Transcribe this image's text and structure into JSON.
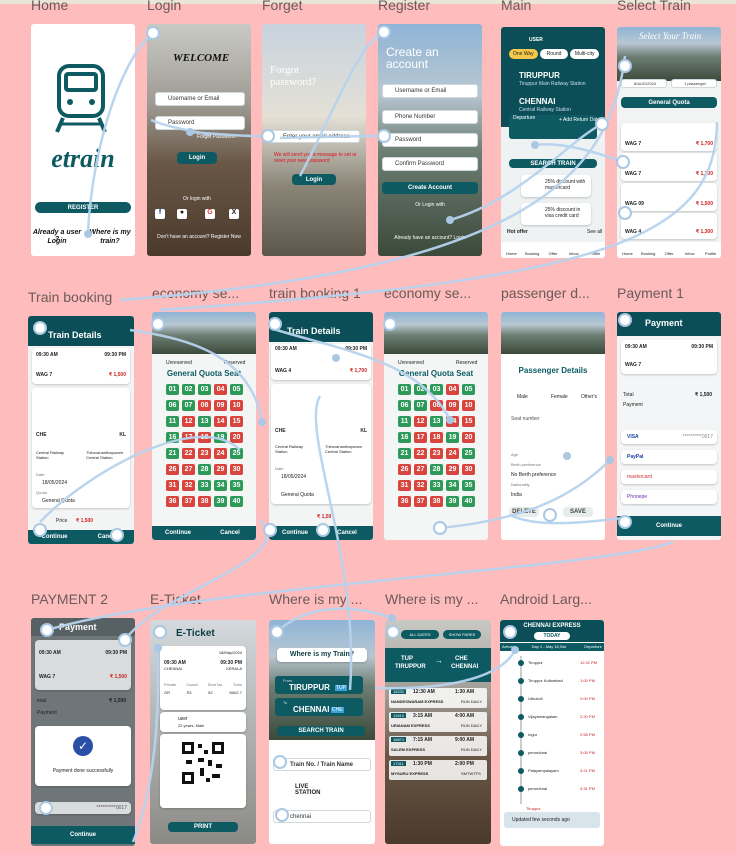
{
  "frames": {
    "home": {
      "label": "Home",
      "logo_text": "etrain",
      "register": "REGISTER",
      "already_user": "Already a user ?",
      "login": "Login",
      "where_is": "Where is my",
      "train": "train?"
    },
    "login": {
      "label": "Login",
      "welcome": "WELCOME",
      "username": "Username or Email",
      "password": "Password",
      "forget": "Forget Password?",
      "login_btn": "Login",
      "or_login": "Or login with",
      "no_account": "Don't have an account? Register Now"
    },
    "forget": {
      "label": "Forget",
      "title": "Forgot password?",
      "email": "Enter your email address",
      "note": "We will send you a message to set or reset your new password",
      "submit": "Login"
    },
    "register": {
      "label": "Register",
      "title": "Create an account",
      "username": "Username or Email",
      "phone": "Phone Number",
      "password": "Password",
      "confirm": "Confirm Password",
      "create": "Create Account",
      "or_login": "Or Login with",
      "already": "Already have an account? Login"
    },
    "main": {
      "label": "Main",
      "user": "USER",
      "tabs": [
        "One Way",
        "Round",
        "Multi-city"
      ],
      "from_code": "TIRUPPUR",
      "from_abbr": "TUP",
      "from_sub": "Tiruppur Main Railway Station",
      "to_code": "CHENNAI",
      "to_abbr": "CHE",
      "to_sub": "Central Railway Station",
      "departure": "Departure",
      "return": "+ Add Return Date",
      "traveller": "Traveller",
      "quota": "General Quota",
      "search": "SEARCH TRAIN",
      "offer1": "25% discount with mastercard",
      "offer2": "25% discount in visa credit card",
      "hot_offer": "Hot offer",
      "see_all": "See all",
      "nav": [
        "Home",
        "Booking",
        "Offer",
        "Inbox",
        "Profile"
      ]
    },
    "select_train": {
      "label": "Select Train",
      "title": "Select Your Train",
      "date": "8/AUG/2024",
      "passenger": "1 passenger",
      "quota": "General Quota",
      "trains": [
        {
          "name": "WAG 7",
          "price": "₹ 1,700"
        },
        {
          "name": "WAG 7",
          "price": "₹ 1,700"
        },
        {
          "name": "WAG 09",
          "price": "₹ 1,500"
        },
        {
          "name": "WAG 4",
          "price": "₹ 1,300"
        }
      ],
      "nav": [
        "Home",
        "Booking",
        "Offer",
        "Inbox",
        "Profile"
      ]
    },
    "train_booking": {
      "label": "Train booking",
      "title": "Train Details",
      "dep_time": "09:30 AM",
      "arr_time": "09:30 PM",
      "train": "WAG 7",
      "price_tag": "₹ 1,500",
      "from": "CHE",
      "to": "KL",
      "from_station": "Central Railway Station",
      "to_station": "Thiruvananthapuram Central Station",
      "date_label": "Date",
      "date": "18/05/2024",
      "quota_label": "Quota",
      "quota": "General Quota",
      "price_label": "Price",
      "price": "₹ 1,500",
      "continue": "Continue",
      "cancel": "Cancel"
    },
    "economy1": {
      "label": "economy se...",
      "unreserved": "Unreserved",
      "reserved": "Reserved",
      "title": "General Quota Seat",
      "continue": "Continue",
      "cancel": "Cancel"
    },
    "train_booking1": {
      "label": "train booking 1",
      "title": "Train Details",
      "dep_time": "09:30 AM",
      "arr_time": "09:30 PM",
      "from": "CHE",
      "to": "KL",
      "train": "WAG 4",
      "price_tag": "₹ 1,700",
      "from_station": "Central Railway Station",
      "to_station": "Thiruvananthapuram Central Station",
      "date_label": "Date",
      "date": "18/05/2024",
      "quota": "General Quota",
      "price": "₹ 1,50",
      "continue": "Continue",
      "cancel": "Cancel"
    },
    "economy2": {
      "label": "economy se...",
      "unreserved": "Unreserved",
      "reserved": "Reserved",
      "title": "General Quota Seat"
    },
    "passenger": {
      "label": "passenger d...",
      "title": "Passenger Details",
      "genders": [
        "Male",
        "Female",
        "Other's"
      ],
      "seat": "Seat number",
      "age": "Age",
      "pref": "Berth preference",
      "no_berth": "No Berth preference",
      "nation": "Nationality",
      "india": "India",
      "delete": "DELETE",
      "save": "SAVE"
    },
    "payment1": {
      "label": "Payment 1",
      "title": "Payment",
      "dep_time": "09:30 AM",
      "arr_time": "09:30 PM",
      "train": "WAG 7",
      "total": "Total",
      "total_val": "₹ 1,500",
      "payment": "Payment",
      "cards": [
        "VISA",
        "PayPal",
        "mastercard",
        "Phonepe"
      ],
      "masked": "**********0017",
      "continue": "Continue"
    },
    "payment2": {
      "label": "PAYMENT 2",
      "title": "Payment",
      "dep_time": "09:30 AM",
      "arr_time": "09:30 PM",
      "train": "WAG 7",
      "price": "₹ 1,500",
      "total": "total",
      "total_val": "₹ 1,500",
      "payment": "Payment",
      "success": "Payment done successfully",
      "masked": "**********0017",
      "continue": "Continue"
    },
    "eticket": {
      "label": "E-Ticket",
      "title": "E-Ticket",
      "date": "18/May/2024",
      "dep": "09:30 AM",
      "from": "CHENNAI",
      "arr": "09:30 PM",
      "to": "KERALA",
      "cols": [
        "Private",
        "Coach",
        "Seat No.",
        "Train"
      ],
      "vals": [
        "GR",
        "S3",
        "52",
        "WAG 7"
      ],
      "user": "user",
      "age": "22 years, Male",
      "print": "PRINT"
    },
    "where1": {
      "label": "Where is my ...",
      "title": "Where is my Train?",
      "from_label": "From",
      "from": "TIRUPPUR",
      "from_abbr": "TUP",
      "to_label": "To",
      "to": "CHENNAI",
      "to_abbr": "CHE",
      "search": "SEARCH TRAIN",
      "name_input": "Train No. / Train Name",
      "live": "LIVE STATION",
      "station": "chennai"
    },
    "where2": {
      "label": "Where is my ...",
      "filter1": "ALL DATES",
      "filter2": "SHOW FARES",
      "from": "TUP",
      "from_full": "TIRUPPUR",
      "to": "CHE",
      "to_full": "CHENNAI",
      "trains": [
        {
          "num": "16231",
          "dep": "12:30 AM",
          "arr": "1:30 AM",
          "name": "NANDESWARAM EXPRESS",
          "run": "RUN DAILY"
        },
        {
          "num": "12610",
          "dep": "3:15 AM",
          "arr": "4:00 AM",
          "name": "URIANAM EXPRESS",
          "run": "RUN DAILY"
        },
        {
          "num": "16871",
          "dep": "7:15 AM",
          "arr": "9:00 AM",
          "name": "SALEM EXPRESS",
          "run": "RUN DAILY"
        },
        {
          "num": "17311",
          "dep": "1:30 PM",
          "arr": "2:00 PM",
          "name": "MYSURU EXPRESS",
          "run": "SMTWTFS"
        }
      ]
    },
    "android": {
      "label": "Android Larg...",
      "header": "CHENNAI EXPRESS",
      "today": "TODAY",
      "cols": [
        "Arrival",
        "Day 1 - May 18,Sat",
        "Departure"
      ],
      "stations": [
        "Tiruppur",
        "Tiruppur Kollambad",
        "Uthukuli",
        "Vijayamangalam",
        "Ingur",
        "perundurai",
        "Palayampalayam",
        "perundurai"
      ],
      "times": [
        "12:31 PM",
        "1:00 PM",
        "2:00 PM",
        "2:20 PM",
        "2:55 PM",
        "3:05 PM",
        "3:21 PM",
        "3:31 PM"
      ],
      "status": "Updated few seconds ago",
      "stop": "Tiruppur"
    }
  }
}
